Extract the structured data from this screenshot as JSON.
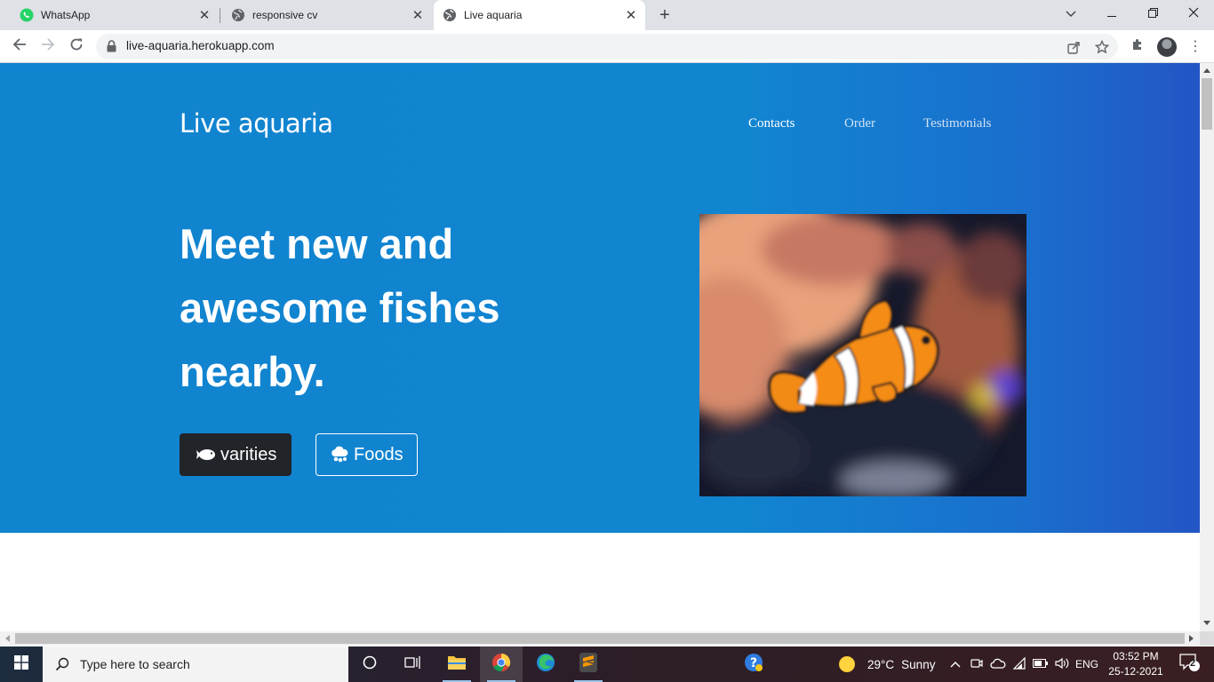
{
  "browser": {
    "tabs": [
      {
        "title": "WhatsApp",
        "icon": "whatsapp-icon",
        "active": false
      },
      {
        "title": "responsive cv",
        "icon": "globe-icon",
        "active": false
      },
      {
        "title": "Live aquaria",
        "icon": "globe-icon",
        "active": true
      }
    ],
    "url": "live-aquaria.herokuapp.com"
  },
  "page": {
    "brand": "Live aquaria",
    "nav": [
      {
        "label": "Contacts",
        "active": true
      },
      {
        "label": "Order",
        "active": false
      },
      {
        "label": "Testimonials",
        "active": false
      }
    ],
    "headline": "Meet new and awesome fishes nearby.",
    "buttons": {
      "primary_label": "varities",
      "secondary_label": "Foods"
    },
    "colors": {
      "hero_start": "#1184d0",
      "hero_end": "#2355c5",
      "dark_button": "#212529"
    }
  },
  "taskbar": {
    "search_placeholder": "Type here to search",
    "weather": {
      "temp": "29°C",
      "condition": "Sunny"
    },
    "language": "ENG",
    "time": "03:52 PM",
    "date": "25-12-2021",
    "notifications": "2"
  }
}
